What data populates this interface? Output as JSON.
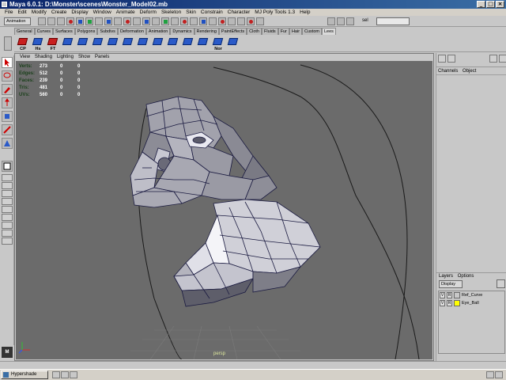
{
  "window": {
    "title": "Maya 6.0.1: D:\\Monster\\scenes\\Monster_Model02.mb",
    "buttons": [
      "_",
      "□",
      "×"
    ]
  },
  "menubar": [
    "File",
    "Edit",
    "Modify",
    "Create",
    "Display",
    "Window",
    "Animate",
    "Deform",
    "Skeleton",
    "Skin",
    "Constrain",
    "Character",
    "MJ Poly Tools 1.3",
    "Help"
  ],
  "statusline": {
    "mode": "Animation",
    "selection_label": "sel"
  },
  "shelf": {
    "tabs": [
      "General",
      "Curves",
      "Surfaces",
      "Polygons",
      "Subdivs",
      "Deformation",
      "Animation",
      "Dynamics",
      "Rendering",
      "PaintEffects",
      "Cloth",
      "Fluids",
      "Fur",
      "Hair",
      "Custom",
      "Lees"
    ],
    "active_tab": "Lees",
    "buttons": [
      {
        "label": "CP",
        "icon": "poly-cube-icon"
      },
      {
        "label": "Hs",
        "icon": "poly-history-icon"
      },
      {
        "label": "FT",
        "icon": "freeze-transform-icon"
      },
      {
        "label": "",
        "icon": "poly-sphere-icon"
      },
      {
        "label": "",
        "icon": "poly-cube-icon"
      },
      {
        "label": "",
        "icon": "poly-extrude-icon"
      },
      {
        "label": "",
        "icon": "poly-split-icon"
      },
      {
        "label": "",
        "icon": "poly-merge-icon"
      },
      {
        "label": "",
        "icon": "poly-bevel-icon"
      },
      {
        "label": "",
        "icon": "poly-smooth-icon"
      },
      {
        "label": "",
        "icon": "poly-append-icon"
      },
      {
        "label": "",
        "icon": "poly-wedge-icon"
      },
      {
        "label": "",
        "icon": "poly-subdivide-icon"
      },
      {
        "label": "Nor",
        "icon": "normals-icon"
      },
      {
        "label": "",
        "icon": "poly-mirror-icon"
      }
    ]
  },
  "panel": {
    "menus": [
      "View",
      "Shading",
      "Lighting",
      "Show",
      "Panels"
    ],
    "hud": [
      {
        "label": "Verts:",
        "v1": "273",
        "v2": "0",
        "v3": "0"
      },
      {
        "label": "Edges:",
        "v1": "512",
        "v2": "0",
        "v3": "0"
      },
      {
        "label": "Faces:",
        "v1": "239",
        "v2": "0",
        "v3": "0"
      },
      {
        "label": "Tris:",
        "v1": "481",
        "v2": "0",
        "v3": "0"
      },
      {
        "label": "UVs:",
        "v1": "560",
        "v2": "0",
        "v3": "0"
      }
    ],
    "camera": "persp"
  },
  "channel_box": {
    "menus": [
      "Channels",
      "Object"
    ]
  },
  "layer_editor": {
    "menus": [
      "Layers",
      "Options"
    ],
    "display_mode": "Display",
    "layers": [
      {
        "v": "V",
        "r": "R",
        "name": "Ref_Curve",
        "color": "#c8c8c8"
      },
      {
        "v": "V",
        "r": "R",
        "name": "Eye_Ball",
        "color": "#ffff00"
      }
    ]
  },
  "taskbar": {
    "item": "Hypershade"
  },
  "colors": {
    "viewport_bg": "#6b6b6b",
    "title_bar": "#0a246a",
    "mesh_face": "#9898a0",
    "wire": "#1a1a40"
  }
}
